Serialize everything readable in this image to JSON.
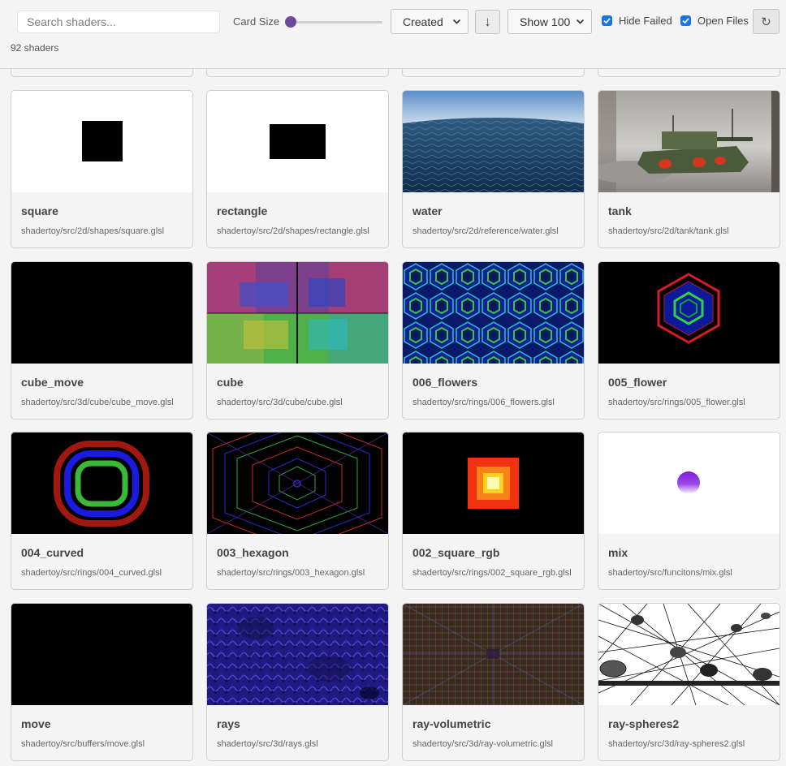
{
  "toolbar": {
    "search_placeholder": "Search shaders...",
    "card_size_label": "Card Size",
    "card_size_value": 0,
    "sort_value": "Created",
    "sort_dir_glyph": "↓",
    "show_value": "Show 100",
    "hide_failed_label": "Hide Failed",
    "hide_failed_checked": true,
    "open_files_label": "Open Files",
    "open_files_checked": true,
    "refresh_glyph": "↻"
  },
  "summary": {
    "count_text": "92 shaders"
  },
  "colors": {
    "accent": "#6a4a9a",
    "checkbox": "#1a73e8"
  },
  "shaders": [
    {
      "name": "square",
      "path": "shadertoy/src/2d/shapes/square.glsl"
    },
    {
      "name": "rectangle",
      "path": "shadertoy/src/2d/shapes/rectangle.glsl"
    },
    {
      "name": "water",
      "path": "shadertoy/src/2d/reference/water.glsl"
    },
    {
      "name": "tank",
      "path": "shadertoy/src/2d/tank/tank.glsl"
    },
    {
      "name": "cube_move",
      "path": "shadertoy/src/3d/cube/cube_move.glsl"
    },
    {
      "name": "cube",
      "path": "shadertoy/src/3d/cube/cube.glsl"
    },
    {
      "name": "006_flowers",
      "path": "shadertoy/src/rings/006_flowers.glsl"
    },
    {
      "name": "005_flower",
      "path": "shadertoy/src/rings/005_flower.glsl"
    },
    {
      "name": "004_curved",
      "path": "shadertoy/src/rings/004_curved.glsl"
    },
    {
      "name": "003_hexagon",
      "path": "shadertoy/src/rings/003_hexagon.glsl"
    },
    {
      "name": "002_square_rgb",
      "path": "shadertoy/src/rings/002_square_rgb.glsl"
    },
    {
      "name": "mix",
      "path": "shadertoy/src/funcitons/mix.glsl"
    },
    {
      "name": "move",
      "path": "shadertoy/src/buffers/move.glsl"
    },
    {
      "name": "rays",
      "path": "shadertoy/src/3d/rays.glsl"
    },
    {
      "name": "ray-volumetric",
      "path": "shadertoy/src/3d/ray-volumetric.glsl"
    },
    {
      "name": "ray-spheres2",
      "path": "shadertoy/src/3d/ray-spheres2.glsl"
    }
  ]
}
